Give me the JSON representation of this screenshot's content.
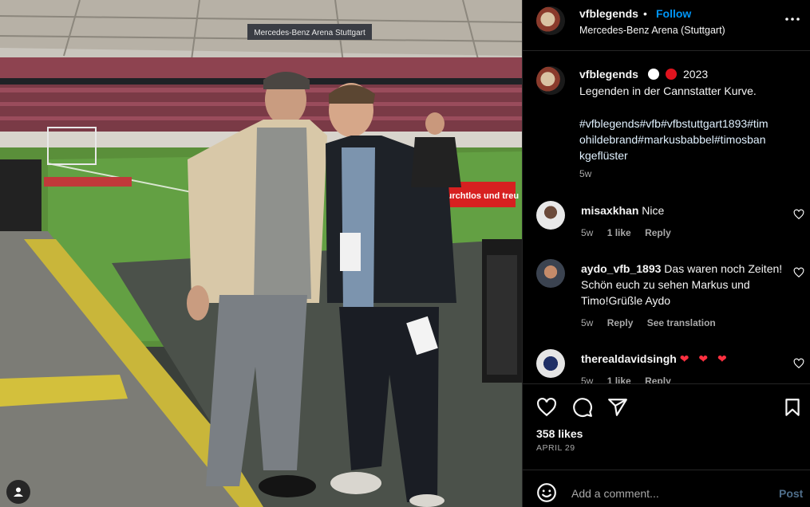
{
  "header": {
    "username": "vfblegends",
    "separator": "•",
    "follow_label": "Follow",
    "location": "Mercedes-Benz Arena (Stuttgart)",
    "more_icon": "more-horizontal-icon"
  },
  "photo": {
    "stadium_sign": "Mercedes-Benz Arena Stuttgart",
    "board_text": "furchtlos und treu"
  },
  "caption": {
    "username": "vfblegends",
    "year": "2023",
    "text": "Legenden in der Cannstatter Kurve.",
    "hashtags": "#vfblegends#vfb#vfbstuttgart1893#timohildebrand#markusbabbel#timosbankgeflüster",
    "time": "5w"
  },
  "comments": [
    {
      "username": "misaxkhan",
      "text": "Nice",
      "time": "5w",
      "likes": "1 like",
      "reply": "Reply"
    },
    {
      "username": "aydo_vfb_1893",
      "text": "Das waren noch Zeiten! Schön euch zu sehen Markus und Timo!Grüßle Aydo",
      "time": "5w",
      "reply": "Reply",
      "translate": "See translation"
    },
    {
      "username": "therealdavidsingh",
      "text": "❤ ❤ ❤",
      "time": "5w",
      "likes": "1 like",
      "reply": "Reply"
    }
  ],
  "actions": {
    "like_icon": "heart-icon",
    "comment_icon": "comment-icon",
    "share_icon": "share-icon",
    "save_icon": "bookmark-icon",
    "likes": "358 likes",
    "date": "APRIL 29"
  },
  "add_comment": {
    "placeholder": "Add a comment...",
    "post_label": "Post"
  },
  "colors": {
    "accent": "#0095f6",
    "background": "#000000",
    "heart": "#ff3040"
  }
}
